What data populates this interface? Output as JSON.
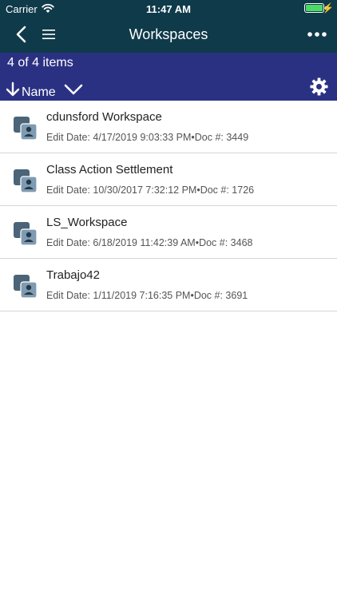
{
  "status": {
    "carrier": "Carrier",
    "time": "11:47 AM"
  },
  "nav": {
    "title": "Workspaces"
  },
  "listbar": {
    "count": "4 of 4 items",
    "sort_field": "Name"
  },
  "items": [
    {
      "name": "cdunsford Workspace",
      "meta": "Edit Date: 4/17/2019 9:03:33 PM•Doc #: 3449"
    },
    {
      "name": "Class Action Settlement",
      "meta": "Edit Date: 10/30/2017 7:32:12 PM•Doc #: 1726"
    },
    {
      "name": "LS_Workspace",
      "meta": "Edit Date: 6/18/2019 11:42:39 AM•Doc #: 3468"
    },
    {
      "name": "Trabajo42",
      "meta": "Edit Date: 1/11/2019 7:16:35 PM•Doc #: 3691"
    }
  ],
  "colors": {
    "header": "#0f3a4a",
    "listbar": "#2b3182",
    "battery": "#4cd964"
  },
  "icons": [
    "wifi-icon",
    "battery-icon",
    "back-chevron-icon",
    "hamburger-menu-icon",
    "more-dots-icon",
    "arrow-down-icon",
    "chevron-down-icon",
    "gear-icon",
    "workspace-icon"
  ]
}
